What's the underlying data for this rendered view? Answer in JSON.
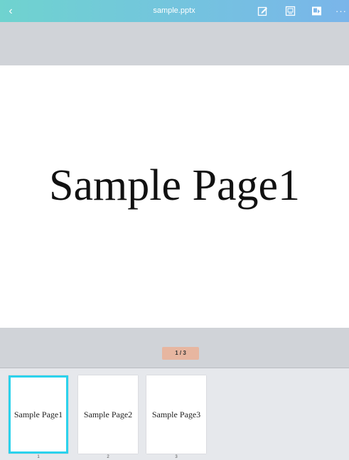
{
  "topbar": {
    "back_glyph": "‹",
    "title": "sample.pptx",
    "more_glyph": "···",
    "tools": [
      {
        "icon": "edit-icon"
      },
      {
        "icon": "present-icon"
      },
      {
        "icon": "export-icon"
      }
    ]
  },
  "slide": {
    "text": "Sample Page1"
  },
  "pager": {
    "label": "1 / 3"
  },
  "thumbnails": [
    {
      "label": "Sample Page1",
      "number": "1",
      "active": true
    },
    {
      "label": "Sample Page2",
      "number": "2",
      "active": false
    },
    {
      "label": "Sample Page3",
      "number": "3",
      "active": false
    }
  ],
  "colors": {
    "accent": "#2bd2ec",
    "header_start": "#6fd3cf",
    "header_end": "#7ab5ea",
    "pager_bg": "#e7b6a0"
  }
}
